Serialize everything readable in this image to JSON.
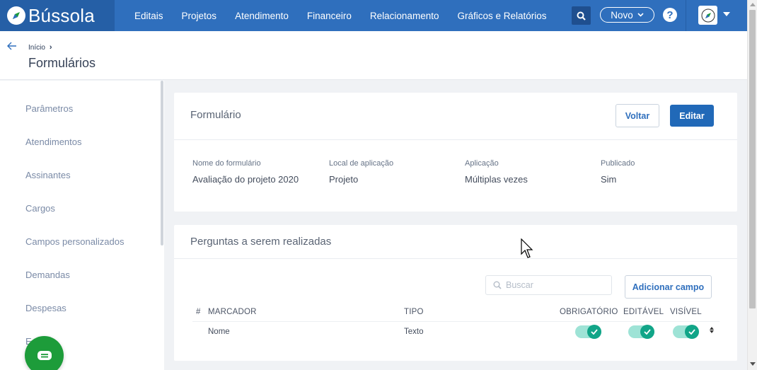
{
  "app": {
    "name": "Bússola"
  },
  "nav": {
    "items": [
      "Editais",
      "Projetos",
      "Atendimento",
      "Financeiro",
      "Relacionamento",
      "Gráficos e Relatórios"
    ],
    "novo_label": "Novo",
    "help_label": "?"
  },
  "header": {
    "breadcrumb": [
      "Início"
    ],
    "title": "Formulários"
  },
  "sidebar": {
    "items": [
      {
        "label": "Parâmetros"
      },
      {
        "label": "Atendimentos"
      },
      {
        "label": "Assinantes"
      },
      {
        "label": "Cargos"
      },
      {
        "label": "Campos personalizados"
      },
      {
        "label": "Demandas"
      },
      {
        "label": "Despesas"
      },
      {
        "label": "E"
      }
    ]
  },
  "form_card": {
    "title": "Formulário",
    "back_label": "Voltar",
    "edit_label": "Editar",
    "fields": [
      {
        "label": "Nome do formulário",
        "value": "Avaliação do projeto 2020"
      },
      {
        "label": "Local de aplicação",
        "value": "Projeto"
      },
      {
        "label": "Aplicação",
        "value": "Múltiplas vezes"
      },
      {
        "label": "Publicado",
        "value": "Sim"
      }
    ]
  },
  "questions_card": {
    "title": "Perguntas a serem realizadas",
    "search_placeholder": "Buscar",
    "add_field_label": "Adicionar campo",
    "columns": [
      "#",
      "MARCADOR",
      "TIPO",
      "OBRIGATÓRIO",
      "EDITÁVEL",
      "VISÍVEL"
    ],
    "rows": [
      {
        "marcador": "Nome",
        "tipo": "Texto",
        "obrigatorio": true,
        "editavel": true,
        "visivel": true
      }
    ]
  },
  "colors": {
    "topbar": "#2f6fbd",
    "logo_bg": "#255fa6",
    "primary_button": "#2169b8",
    "toggle_on": "#11a588",
    "toggle_track": "#9ee3d6",
    "chat_button": "#1d9c3a"
  },
  "icons": [
    "compass-logo-icon",
    "search-icon",
    "chevron-down-icon",
    "help-icon",
    "avatar-icon",
    "caret-down-icon",
    "back-arrow-icon",
    "check-icon",
    "sort-icon",
    "chat-icon",
    "cursor-icon"
  ]
}
